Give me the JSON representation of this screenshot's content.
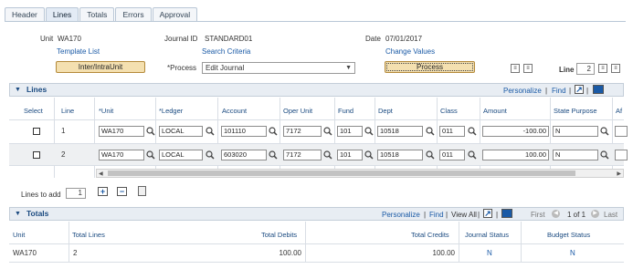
{
  "tabs": [
    "Header",
    "Lines",
    "Totals",
    "Errors",
    "Approval"
  ],
  "header": {
    "unit_label": "Unit",
    "unit_value": "WA170",
    "journal_id_label": "Journal ID",
    "journal_id_value": "STANDARD01",
    "date_label": "Date",
    "date_value": "07/01/2017",
    "template_list": "Template List",
    "search_criteria": "Search Criteria",
    "change_values": "Change Values",
    "inter_button": "Inter/IntraUnit",
    "process_label": "*Process",
    "process_value": "Edit Journal",
    "process_button": "Process",
    "line_label": "Line",
    "line_value": "2"
  },
  "lines_grid": {
    "title": "Lines",
    "personalize": "Personalize",
    "sep": "|",
    "find": "Find",
    "columns": [
      "Select",
      "Line",
      "*Unit",
      "*Ledger",
      "Account",
      "Oper Unit",
      "Fund",
      "Dept",
      "Class",
      "Amount",
      "State Purpose",
      "Af"
    ],
    "rows": [
      {
        "line": "1",
        "unit": "WA170",
        "ledger": "LOCAL",
        "account": "101110",
        "oper_unit": "7172",
        "fund": "101",
        "dept": "10518",
        "class": "011",
        "amount": "-100.00",
        "state_purpose": "N"
      },
      {
        "line": "2",
        "unit": "WA170",
        "ledger": "LOCAL",
        "account": "603020",
        "oper_unit": "7172",
        "fund": "101",
        "dept": "10518",
        "class": "011",
        "amount": "100.00",
        "state_purpose": "N"
      }
    ],
    "lines_to_add_label": "Lines to add",
    "lines_to_add_value": "1"
  },
  "totals_grid": {
    "title": "Totals",
    "personalize": "Personalize",
    "find": "Find",
    "view_all": "View All",
    "first": "First",
    "pager": "1 of 1",
    "last": "Last",
    "columns": [
      "Unit",
      "Total Lines",
      "Total Debits",
      "Total Credits",
      "Journal Status",
      "Budget Status"
    ],
    "row": {
      "unit": "WA170",
      "total_lines": "2",
      "total_debits": "100.00",
      "total_credits": "100.00",
      "journal_status": "N",
      "budget_status": "N"
    }
  },
  "colors": {
    "link": "#1a5aa6",
    "header_blue": "#1a4a80",
    "button": "#f4e0b0"
  }
}
